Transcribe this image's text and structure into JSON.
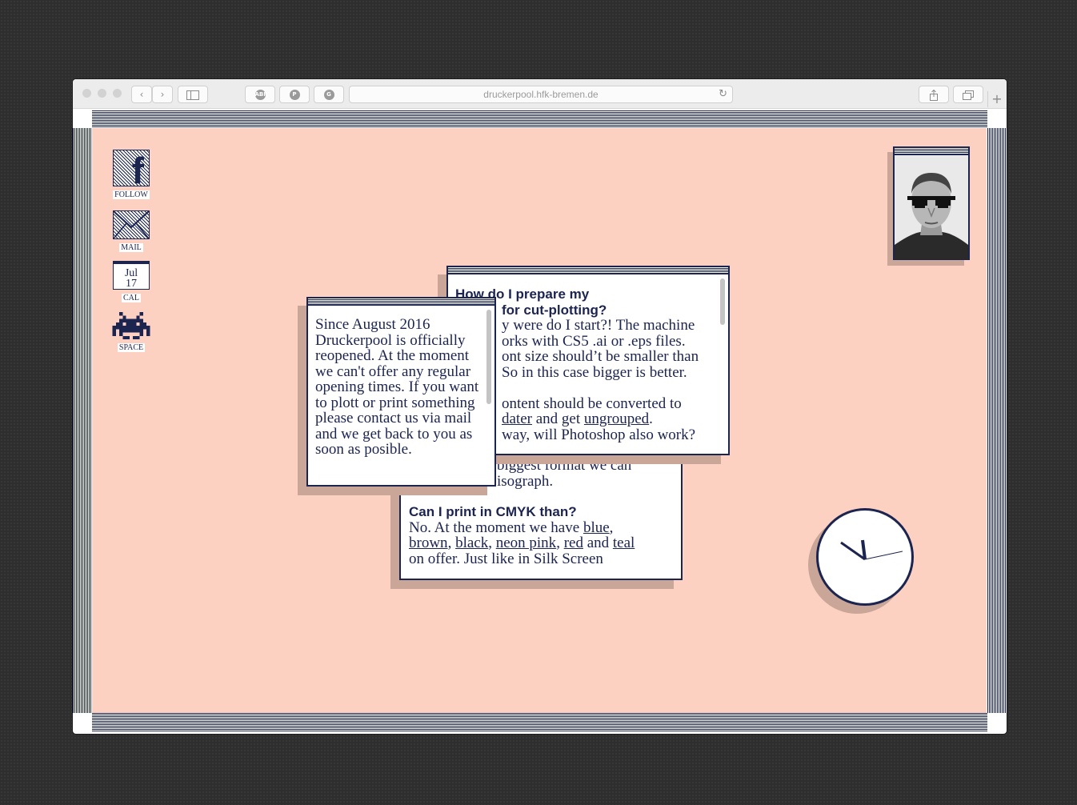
{
  "browser": {
    "url": "druckerpool.hfk-bremen.de",
    "back_label": "‹",
    "forward_label": "›",
    "new_tab_label": "+"
  },
  "sidebar_icons": [
    {
      "label": "FOLLOW",
      "icon": "facebook-icon",
      "glyph": "f"
    },
    {
      "label": "MAIL",
      "icon": "mail-icon"
    },
    {
      "label": "CAL",
      "icon": "calendar-icon",
      "month": "Jul",
      "day": "17"
    },
    {
      "label": "SPACE",
      "icon": "space-invader-icon"
    }
  ],
  "win_notice": {
    "text": "Since August 2016 Druckerpool is officially reopened. At the moment we can't offer any regular opening times. If you want to plott or print something please contact us via mail and we get back to you as soon as posible."
  },
  "win_cutplot": {
    "heading_l1": "How do I prepare my",
    "heading_l2": "for cut-plotting?",
    "p1_l1": "y were do I start?! The machine",
    "p1_l2": "orks with CS5 .ai or .eps files.",
    "p1_l3": "ont size should’t be smaller than",
    "p1_l4": "So in this case bigger is better.",
    "p2_l1": "ontent should be converted to",
    "p2_link1": "dater",
    "p2_mid": " and get ",
    "p2_link2": "ungrouped",
    "p2_end": ".",
    "p3": " way, will Photoshop also work?"
  },
  "win_riso": {
    "p1_l1": "biggest format we can",
    "p1_l2": "isograph.",
    "heading": "Can I print in CMYK than?",
    "text_start": "No. At the moment we have ",
    "colors": [
      "blue",
      "brown",
      "black",
      "neon pink",
      "red",
      "teal"
    ],
    "sep_comma": ", ",
    "sep_and": " and ",
    "text_end": "on offer. Just like in Silk Screen"
  },
  "colors": {
    "desktop": "#fdd1c2",
    "ink": "#1c2450",
    "shadow": "#c9a698"
  }
}
